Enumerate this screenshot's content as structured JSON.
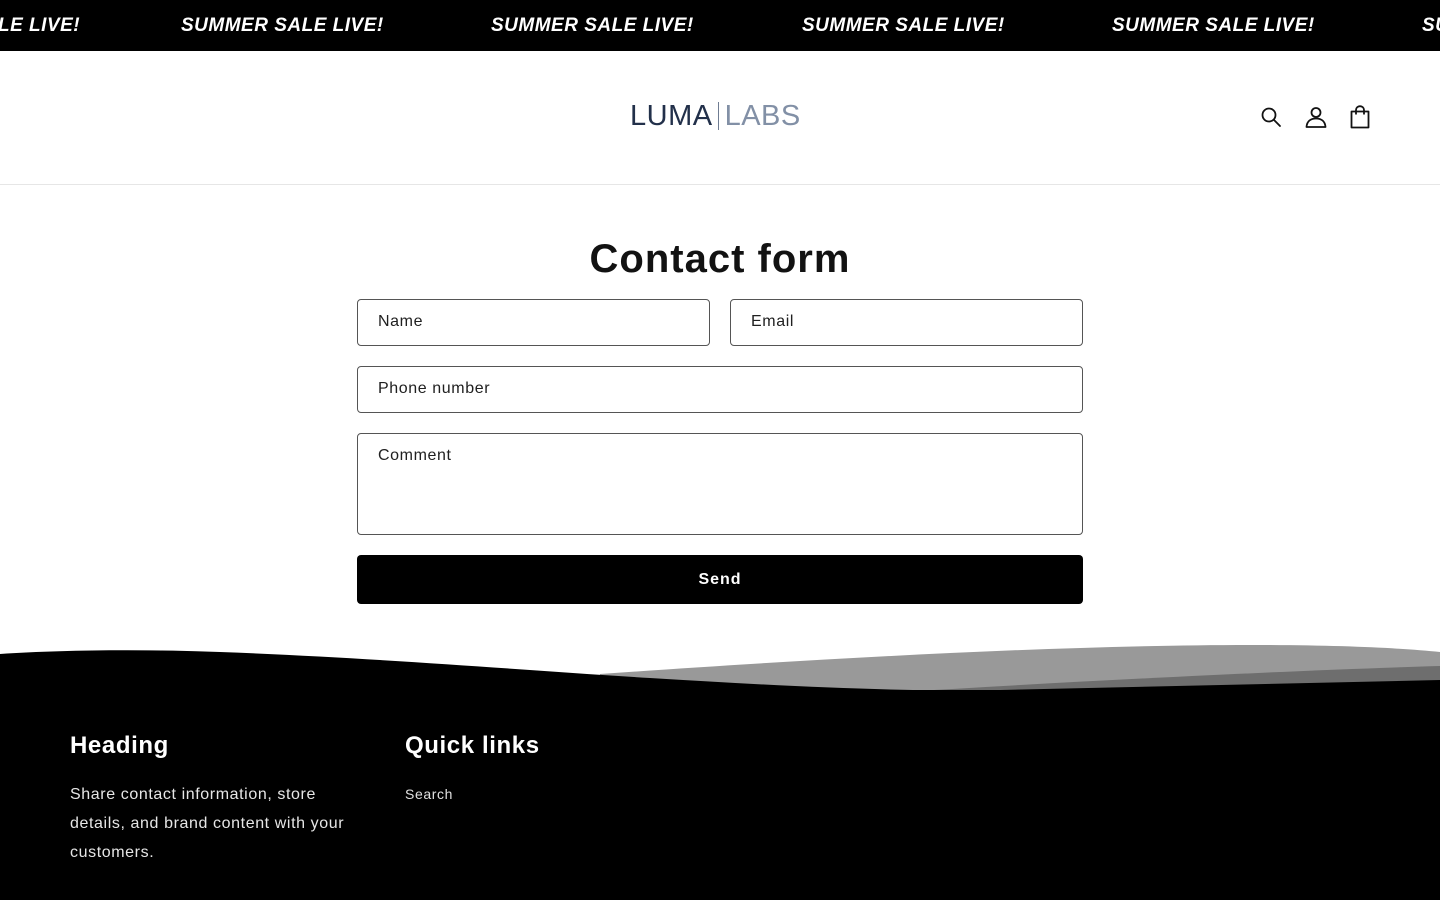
{
  "announcement": {
    "messages": [
      "LE LIVE!",
      "SUMMER SALE LIVE!",
      "SUMMER SALE LIVE!",
      "SUMMER SALE LIVE!",
      "SUMMER SALE LIVE!",
      "SU"
    ]
  },
  "header": {
    "logo": {
      "left_text": "LUMA",
      "right_text": "LABS"
    },
    "icons": [
      "search-icon",
      "account-icon",
      "cart-icon"
    ]
  },
  "form": {
    "title": "Contact form",
    "name_label": "Name",
    "email_label": "Email",
    "phone_label": "Phone number",
    "comment_label": "Comment",
    "send_label": "Send"
  },
  "footer": {
    "col1": {
      "heading": "Heading",
      "text": "Share contact information, store details, and brand content with your customers."
    },
    "col2": {
      "heading": "Quick links",
      "links": [
        "Search"
      ]
    }
  },
  "colors": {
    "announcement_bg": "#000000",
    "footer_bg": "#000000",
    "button_bg": "#000000",
    "logo_dark": "#22304a",
    "logo_light": "#8290a6"
  }
}
